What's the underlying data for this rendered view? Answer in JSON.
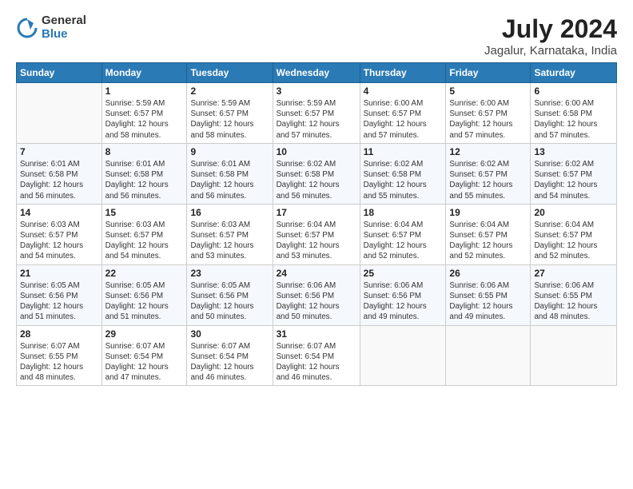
{
  "header": {
    "logo_line1": "General",
    "logo_line2": "Blue",
    "title": "July 2024",
    "subtitle": "Jagalur, Karnataka, India"
  },
  "days_of_week": [
    "Sunday",
    "Monday",
    "Tuesday",
    "Wednesday",
    "Thursday",
    "Friday",
    "Saturday"
  ],
  "weeks": [
    [
      {
        "day": "",
        "info": ""
      },
      {
        "day": "1",
        "info": "Sunrise: 5:59 AM\nSunset: 6:57 PM\nDaylight: 12 hours\nand 58 minutes."
      },
      {
        "day": "2",
        "info": "Sunrise: 5:59 AM\nSunset: 6:57 PM\nDaylight: 12 hours\nand 58 minutes."
      },
      {
        "day": "3",
        "info": "Sunrise: 5:59 AM\nSunset: 6:57 PM\nDaylight: 12 hours\nand 57 minutes."
      },
      {
        "day": "4",
        "info": "Sunrise: 6:00 AM\nSunset: 6:57 PM\nDaylight: 12 hours\nand 57 minutes."
      },
      {
        "day": "5",
        "info": "Sunrise: 6:00 AM\nSunset: 6:57 PM\nDaylight: 12 hours\nand 57 minutes."
      },
      {
        "day": "6",
        "info": "Sunrise: 6:00 AM\nSunset: 6:58 PM\nDaylight: 12 hours\nand 57 minutes."
      }
    ],
    [
      {
        "day": "7",
        "info": "Sunrise: 6:01 AM\nSunset: 6:58 PM\nDaylight: 12 hours\nand 56 minutes."
      },
      {
        "day": "8",
        "info": "Sunrise: 6:01 AM\nSunset: 6:58 PM\nDaylight: 12 hours\nand 56 minutes."
      },
      {
        "day": "9",
        "info": "Sunrise: 6:01 AM\nSunset: 6:58 PM\nDaylight: 12 hours\nand 56 minutes."
      },
      {
        "day": "10",
        "info": "Sunrise: 6:02 AM\nSunset: 6:58 PM\nDaylight: 12 hours\nand 56 minutes."
      },
      {
        "day": "11",
        "info": "Sunrise: 6:02 AM\nSunset: 6:58 PM\nDaylight: 12 hours\nand 55 minutes."
      },
      {
        "day": "12",
        "info": "Sunrise: 6:02 AM\nSunset: 6:57 PM\nDaylight: 12 hours\nand 55 minutes."
      },
      {
        "day": "13",
        "info": "Sunrise: 6:02 AM\nSunset: 6:57 PM\nDaylight: 12 hours\nand 54 minutes."
      }
    ],
    [
      {
        "day": "14",
        "info": "Sunrise: 6:03 AM\nSunset: 6:57 PM\nDaylight: 12 hours\nand 54 minutes."
      },
      {
        "day": "15",
        "info": "Sunrise: 6:03 AM\nSunset: 6:57 PM\nDaylight: 12 hours\nand 54 minutes."
      },
      {
        "day": "16",
        "info": "Sunrise: 6:03 AM\nSunset: 6:57 PM\nDaylight: 12 hours\nand 53 minutes."
      },
      {
        "day": "17",
        "info": "Sunrise: 6:04 AM\nSunset: 6:57 PM\nDaylight: 12 hours\nand 53 minutes."
      },
      {
        "day": "18",
        "info": "Sunrise: 6:04 AM\nSunset: 6:57 PM\nDaylight: 12 hours\nand 52 minutes."
      },
      {
        "day": "19",
        "info": "Sunrise: 6:04 AM\nSunset: 6:57 PM\nDaylight: 12 hours\nand 52 minutes."
      },
      {
        "day": "20",
        "info": "Sunrise: 6:04 AM\nSunset: 6:57 PM\nDaylight: 12 hours\nand 52 minutes."
      }
    ],
    [
      {
        "day": "21",
        "info": "Sunrise: 6:05 AM\nSunset: 6:56 PM\nDaylight: 12 hours\nand 51 minutes."
      },
      {
        "day": "22",
        "info": "Sunrise: 6:05 AM\nSunset: 6:56 PM\nDaylight: 12 hours\nand 51 minutes."
      },
      {
        "day": "23",
        "info": "Sunrise: 6:05 AM\nSunset: 6:56 PM\nDaylight: 12 hours\nand 50 minutes."
      },
      {
        "day": "24",
        "info": "Sunrise: 6:06 AM\nSunset: 6:56 PM\nDaylight: 12 hours\nand 50 minutes."
      },
      {
        "day": "25",
        "info": "Sunrise: 6:06 AM\nSunset: 6:56 PM\nDaylight: 12 hours\nand 49 minutes."
      },
      {
        "day": "26",
        "info": "Sunrise: 6:06 AM\nSunset: 6:55 PM\nDaylight: 12 hours\nand 49 minutes."
      },
      {
        "day": "27",
        "info": "Sunrise: 6:06 AM\nSunset: 6:55 PM\nDaylight: 12 hours\nand 48 minutes."
      }
    ],
    [
      {
        "day": "28",
        "info": "Sunrise: 6:07 AM\nSunset: 6:55 PM\nDaylight: 12 hours\nand 48 minutes."
      },
      {
        "day": "29",
        "info": "Sunrise: 6:07 AM\nSunset: 6:54 PM\nDaylight: 12 hours\nand 47 minutes."
      },
      {
        "day": "30",
        "info": "Sunrise: 6:07 AM\nSunset: 6:54 PM\nDaylight: 12 hours\nand 46 minutes."
      },
      {
        "day": "31",
        "info": "Sunrise: 6:07 AM\nSunset: 6:54 PM\nDaylight: 12 hours\nand 46 minutes."
      },
      {
        "day": "",
        "info": ""
      },
      {
        "day": "",
        "info": ""
      },
      {
        "day": "",
        "info": ""
      }
    ]
  ]
}
